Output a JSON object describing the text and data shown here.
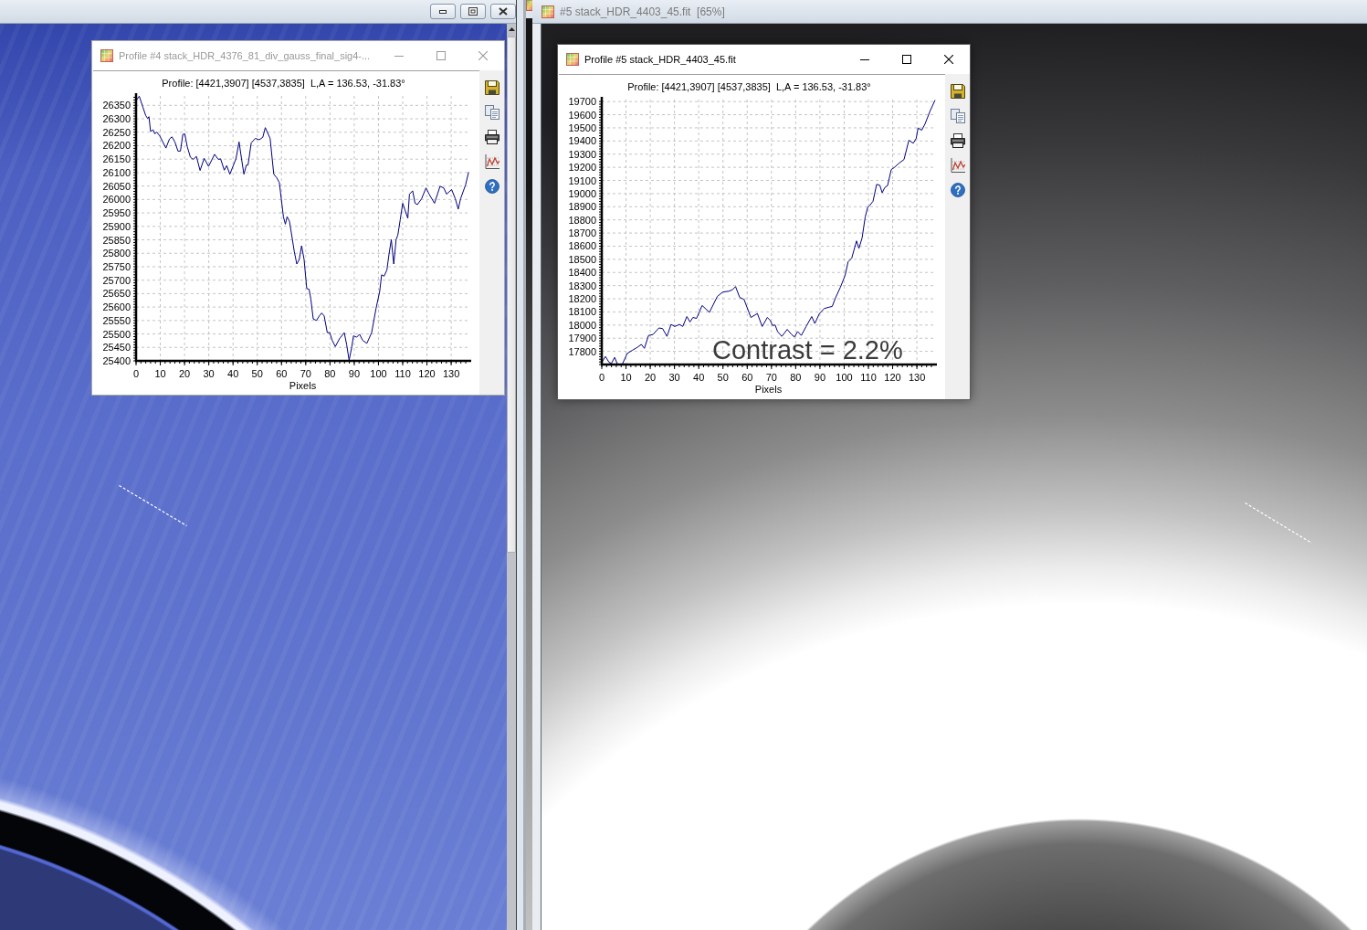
{
  "image_windows": [
    {
      "kind": "enhanced"
    },
    {
      "kind": "original",
      "title": "#5 stack_HDR_4403_45.fit  [65%]"
    }
  ],
  "profile_windows": [
    {
      "title": "Profile #4 stack_HDR_4376_81_div_gauss_final_sig4-...",
      "active": false,
      "chart_data": {
        "type": "line",
        "title": "Profile: [4421,3907] [4537,3835]  L,A = 136.53, -31.83°",
        "xlabel": "Pixels",
        "grid": true,
        "x": [
          0,
          1.3,
          2.8,
          4,
          4.8,
          5.3,
          6,
          7,
          7.8,
          8.5,
          9.8,
          12.3,
          13.8,
          14.8,
          16,
          17.3,
          18.3,
          19.3,
          20.1,
          21.1,
          22.4,
          23.6,
          24.9,
          26.4,
          28.1,
          29.9,
          32.4,
          33.9,
          34.9,
          36.4,
          37.4,
          38.7,
          41.2,
          42.5,
          43.5,
          44.5,
          45.5,
          46.2,
          47.5,
          49.2,
          50.8,
          52.3,
          53.3,
          55.3,
          56.8,
          58,
          59.1,
          60.8,
          61.6,
          62.3,
          63.3,
          64.3,
          65.3,
          66.3,
          67.3,
          68.3,
          69.3,
          70.4,
          71.4,
          72.1,
          73.1,
          74.4,
          75.6,
          76.6,
          77.6,
          78.9,
          79.9,
          80.9,
          82.2,
          83.9,
          85.9,
          86.9,
          87.9,
          89,
          89.7,
          91,
          92.2,
          93.5,
          95.2,
          97.2,
          99,
          100.5,
          101.3,
          102.3,
          103.5,
          104.3,
          105.3,
          106.3,
          107.3,
          108,
          109,
          110,
          112.1,
          112.8,
          114.1,
          115.1,
          116.1,
          117.8,
          119.6,
          120.9,
          123.1,
          125.4,
          126.9,
          128.1,
          130.2,
          131.7,
          132.9,
          133.9,
          135.9,
          137.2
        ],
        "values": [
          26367,
          26384,
          26344,
          26312,
          26301,
          26308,
          26253,
          26259,
          26244,
          26251,
          26236,
          26191,
          26225,
          26233,
          26214,
          26180,
          26180,
          26242,
          26244,
          26197,
          26157,
          26149,
          26160,
          26108,
          26153,
          26123,
          26168,
          26149,
          26151,
          26109,
          26126,
          26094,
          26151,
          26214,
          26151,
          26094,
          26128,
          26128,
          26210,
          26227,
          26222,
          26231,
          26267,
          26227,
          26094,
          26081,
          26063,
          25935,
          25908,
          25936,
          25919,
          25862,
          25806,
          25760,
          25777,
          25828,
          25777,
          25669,
          25666,
          25630,
          25556,
          25550,
          25567,
          25578,
          25567,
          25505,
          25505,
          25476,
          25453,
          25482,
          25505,
          25459,
          25402,
          25453,
          25493,
          25488,
          25499,
          25476,
          25465,
          25505,
          25595,
          25658,
          25720,
          25715,
          25738,
          25794,
          25851,
          25760,
          25851,
          25868,
          25925,
          25986,
          25930,
          26020,
          26032,
          25986,
          25981,
          26003,
          26043,
          26020,
          25986,
          26049,
          26043,
          26020,
          26037,
          26003,
          25964,
          26003,
          26054,
          26102
        ],
        "xlim": [
          0,
          137.5
        ],
        "ylim": [
          25400,
          26385
        ],
        "xticks": [
          0,
          10,
          20,
          30,
          40,
          50,
          60,
          70,
          80,
          90,
          100,
          110,
          120,
          130
        ],
        "yticks": [
          25400,
          25450,
          25500,
          25550,
          25600,
          25650,
          25700,
          25750,
          25800,
          25850,
          25900,
          25950,
          26000,
          26050,
          26100,
          26150,
          26200,
          26250,
          26300,
          26350
        ]
      }
    },
    {
      "title": "Profile #5 stack_HDR_4403_45.fit",
      "active": true,
      "chart_data": {
        "type": "line",
        "title": "Profile: [4421,3907] [4537,3835]  L,A = 136.53, -31.83°",
        "xlabel": "Pixels",
        "grid": true,
        "x": [
          0,
          1.5,
          3,
          4,
          5.3,
          6.5,
          8.5,
          10.5,
          12.5,
          14.6,
          16.3,
          17.6,
          19.3,
          21.1,
          23.6,
          25.1,
          26.9,
          28.6,
          30.1,
          32.1,
          33.4,
          35.1,
          36.4,
          37.6,
          39.1,
          41.4,
          44.4,
          47.7,
          49.9,
          52.4,
          54,
          55.2,
          56.9,
          58.7,
          61.5,
          64.2,
          66.2,
          68.3,
          69.5,
          70.5,
          71.5,
          72.5,
          74.3,
          76.5,
          78.3,
          79.5,
          80.8,
          82.3,
          84.3,
          86.6,
          87.9,
          89.8,
          91.8,
          94.1,
          95.1,
          96.4,
          98.4,
          100.4,
          101.6,
          103.1,
          105.1,
          106.1,
          107.4,
          108.7,
          109.7,
          110.4,
          111.9,
          113.4,
          114.7,
          115.7,
          116.7,
          117.9,
          119.4,
          120.7,
          122.5,
          124.7,
          126.7,
          128.5,
          129.7,
          130.5,
          132,
          133.3,
          135.5,
          137.5
        ],
        "values": [
          17716,
          17761,
          17716,
          17709,
          17754,
          17700,
          17704,
          17784,
          17807,
          17830,
          17853,
          17823,
          17921,
          17928,
          17978,
          17973,
          17914,
          18005,
          17989,
          18005,
          17989,
          18065,
          18024,
          18058,
          18051,
          18149,
          18097,
          18218,
          18252,
          18257,
          18270,
          18293,
          18211,
          18195,
          18058,
          18088,
          17989,
          18058,
          18035,
          17996,
          18001,
          17951,
          17914,
          17967,
          17928,
          17910,
          17951,
          17921,
          17989,
          18065,
          18012,
          18088,
          18126,
          18138,
          18142,
          18206,
          18286,
          18378,
          18480,
          18508,
          18640,
          18583,
          18663,
          18823,
          18895,
          18907,
          18941,
          19070,
          19063,
          19006,
          19045,
          19061,
          19183,
          19199,
          19229,
          19259,
          19406,
          19383,
          19420,
          19498,
          19482,
          19528,
          19631,
          19711
        ],
        "xlim": [
          0,
          137.5
        ],
        "ylim": [
          17700,
          19715
        ],
        "xticks": [
          0,
          10,
          20,
          30,
          40,
          50,
          60,
          70,
          80,
          90,
          100,
          110,
          120,
          130
        ],
        "yticks": [
          17800,
          17900,
          18000,
          18100,
          18200,
          18300,
          18400,
          18500,
          18600,
          18700,
          18800,
          18900,
          19000,
          19100,
          19200,
          19300,
          19400,
          19500,
          19600,
          19700
        ],
        "annotations": [
          "Contrast = 2.2%"
        ]
      }
    }
  ]
}
